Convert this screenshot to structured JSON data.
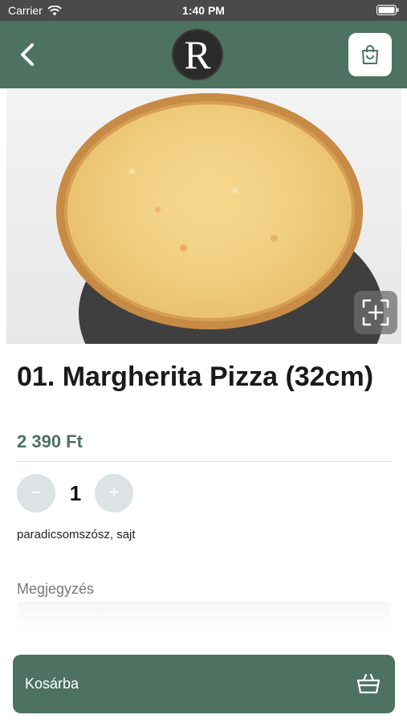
{
  "status_bar": {
    "carrier": "Carrier",
    "time": "1:40 PM"
  },
  "header": {
    "logo_letter": "R",
    "back_icon": "chevron-left-icon",
    "cart_icon": "shopping-bag-icon"
  },
  "product": {
    "title": "01. Margherita Pizza (32cm)",
    "price": "2 390 Ft",
    "quantity": "1",
    "minus_label": "−",
    "plus_label": "+",
    "ingredients": "paradicsomszósz, sajt"
  },
  "note": {
    "label": "Megjegyzés",
    "value": "",
    "placeholder": ""
  },
  "add_to_cart": {
    "label": "Kosárba",
    "icon": "basket-icon"
  },
  "colors": {
    "brand": "#4d7261",
    "status_bar": "#4a4a4a",
    "qty_button": "#dde3e4"
  }
}
